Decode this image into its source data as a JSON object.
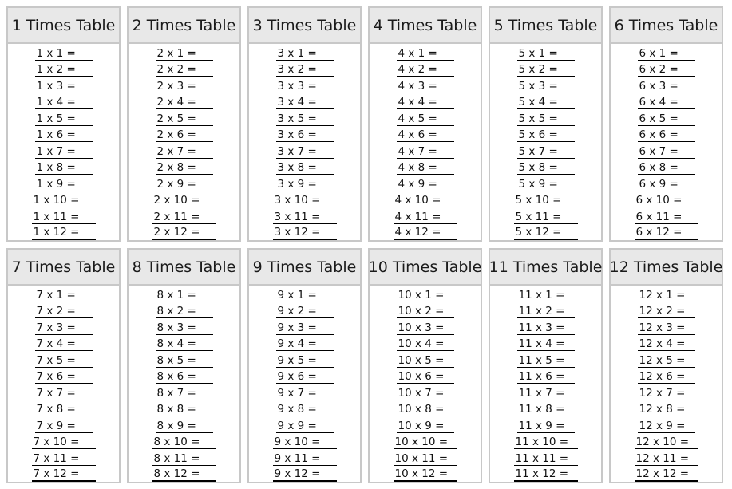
{
  "document": {
    "tables": [
      {
        "title": "1 Times Table",
        "n": 1,
        "rows": [
          "1 x 1 =",
          "1 x 2 =",
          "1 x 3 =",
          "1 x 4 =",
          "1 x 5 =",
          "1 x 6 =",
          "1 x 7 =",
          "1 x 8 =",
          "1 x 9 =",
          "1 x 10 =",
          "1 x 11 =",
          "1 x 12 ="
        ]
      },
      {
        "title": "2 Times Table",
        "n": 2,
        "rows": [
          "2 x 1 =",
          "2 x 2 =",
          "2 x 3 =",
          "2 x 4 =",
          "2 x 5 =",
          "2 x 6 =",
          "2 x 7 =",
          "2 x 8 =",
          "2 x 9 =",
          "2 x 10 =",
          "2 x 11 =",
          "2 x 12 ="
        ]
      },
      {
        "title": "3 Times Table",
        "n": 3,
        "rows": [
          "3 x 1 =",
          "3 x 2 =",
          "3 x 3 =",
          "3 x 4 =",
          "3 x 5 =",
          "3 x 6 =",
          "3 x 7 =",
          "3 x 8 =",
          "3 x 9 =",
          "3 x 10 =",
          "3 x 11 =",
          "3 x 12 ="
        ]
      },
      {
        "title": "4 Times Table",
        "n": 4,
        "rows": [
          "4 x 1 =",
          "4 x 2 =",
          "4 x 3 =",
          "4 x 4 =",
          "4 x 5 =",
          "4 x 6 =",
          "4 x 7 =",
          "4 x 8 =",
          "4 x 9 =",
          "4 x 10 =",
          "4 x 11 =",
          "4 x 12 ="
        ]
      },
      {
        "title": "5 Times Table",
        "n": 5,
        "rows": [
          "5 x 1 =",
          "5 x 2 =",
          "5 x 3 =",
          "5 x 4 =",
          "5 x 5 =",
          "5 x 6 =",
          "5 x 7 =",
          "5 x 8 =",
          "5 x 9 =",
          "5 x 10 =",
          "5 x 11 =",
          "5 x 12 ="
        ]
      },
      {
        "title": "6 Times Table",
        "n": 6,
        "rows": [
          "6 x 1 =",
          "6 x 2 =",
          "6 x 3 =",
          "6 x 4 =",
          "6 x 5 =",
          "6 x 6 =",
          "6 x 7 =",
          "6 x 8 =",
          "6 x 9 =",
          "6 x 10 =",
          "6 x 11 =",
          "6 x 12 ="
        ]
      },
      {
        "title": "7 Times Table",
        "n": 7,
        "rows": [
          "7 x 1 =",
          "7 x 2 =",
          "7 x 3 =",
          "7 x 4 =",
          "7 x 5 =",
          "7 x 6 =",
          "7 x 7 =",
          "7 x 8 =",
          "7 x 9 =",
          "7 x 10 =",
          "7 x 11 =",
          "7 x 12 ="
        ]
      },
      {
        "title": "8 Times Table",
        "n": 8,
        "rows": [
          "8 x 1 =",
          "8 x 2 =",
          "8 x 3 =",
          "8 x 4 =",
          "8 x 5 =",
          "8 x 6 =",
          "8 x 7 =",
          "8 x 8 =",
          "8 x 9 =",
          "8 x 10 =",
          "8 x 11 =",
          "8 x 12 ="
        ]
      },
      {
        "title": "9 Times Table",
        "n": 9,
        "rows": [
          "9 x 1 =",
          "9 x 2 =",
          "9 x 3 =",
          "9 x 4 =",
          "9 x 5 =",
          "9 x 6 =",
          "9 x 7 =",
          "9 x 8 =",
          "9 x 9 =",
          "9 x 10 =",
          "9 x 11 =",
          "9 x 12 ="
        ]
      },
      {
        "title": "10 Times Table",
        "n": 10,
        "rows": [
          "10 x 1 =",
          "10 x 2 =",
          "10 x 3 =",
          "10 x 4 =",
          "10 x 5 =",
          "10 x 6 =",
          "10 x 7 =",
          "10 x 8 =",
          "10 x 9 =",
          "10 x 10 =",
          "10 x 11 =",
          "10 x 12 ="
        ]
      },
      {
        "title": "11 Times Table",
        "n": 11,
        "rows": [
          "11 x 1 =",
          "11 x 2 =",
          "11 x 3 =",
          "11 x 4 =",
          "11 x 5 =",
          "11 x 6 =",
          "11 x 7 =",
          "11 x 8 =",
          "11 x 9 =",
          "11 x 10 =",
          "11 x 11 =",
          "11 x 12 ="
        ]
      },
      {
        "title": "12 Times Table",
        "n": 12,
        "rows": [
          "12 x 1 =",
          "12 x 2 =",
          "12 x 3 =",
          "12 x 4 =",
          "12 x 5 =",
          "12 x 6 =",
          "12 x 7 =",
          "12 x 8 =",
          "12 x 9 =",
          "12 x 10 =",
          "12 x 11 =",
          "12 x 12 ="
        ]
      }
    ],
    "colors": {
      "header_bg": "#e8e8e8",
      "border": "#c8c8c8",
      "text": "#111111",
      "line": "#000000"
    }
  }
}
